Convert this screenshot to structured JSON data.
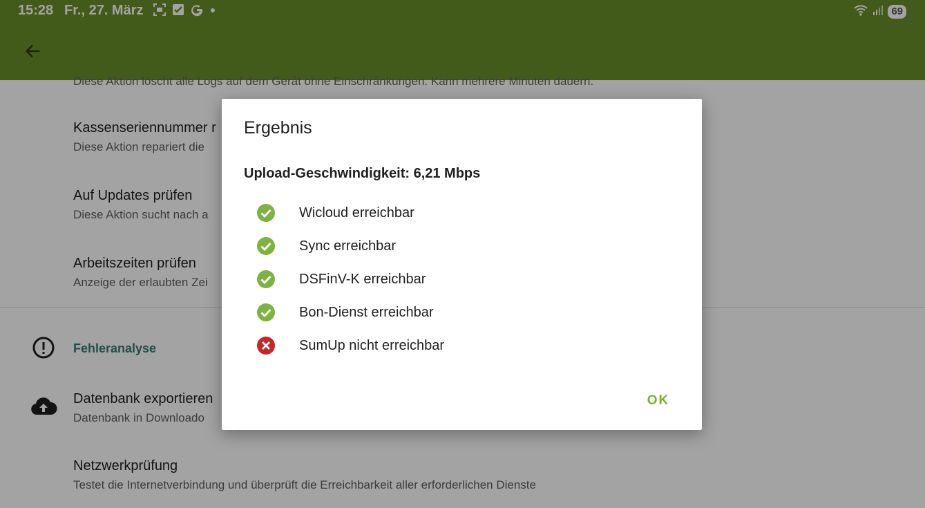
{
  "status_bar": {
    "time": "15:28",
    "date": "Fr., 27. März",
    "battery": "69",
    "icons": [
      "screenshot-icon",
      "task-check-icon",
      "google-icon",
      "dot-icon",
      "wifi-icon",
      "signal-icon"
    ]
  },
  "app_bar": {
    "back_icon": "back-arrow-icon",
    "color": "#6a8f2a"
  },
  "settings": {
    "truncated_top_subtitle": "Diese Aktion löscht alle Logs auf dem Gerät ohne Einschränkungen. Kann mehrere Minuten dauern.",
    "items": [
      {
        "title": "Kassenseriennummer r",
        "subtitle": "Diese Aktion repariert die"
      },
      {
        "title": "Auf Updates prüfen",
        "subtitle": "Diese Aktion sucht nach a"
      },
      {
        "title": "Arbeitszeiten prüfen",
        "subtitle": "Anzeige der erlaubten Zei"
      }
    ],
    "section": {
      "title": "Fehleranalyse",
      "icon": "alert-circle-icon",
      "color": "#2f7d74"
    },
    "section_items": [
      {
        "title": "Datenbank exportieren",
        "subtitle": "Datenbank in Downloado",
        "icon": "cloud-upload-icon"
      },
      {
        "title": "Netzwerkprüfung",
        "subtitle": "Testet die Internetverbindung und überprüft die Erreichbarkeit aller erforderlichen Dienste"
      }
    ]
  },
  "dialog": {
    "title": "Ergebnis",
    "upload_speed": "Upload-Geschwindigkeit: 6,21 Mbps",
    "checks": [
      {
        "label": "Wicloud erreichbar",
        "status": "ok",
        "icon": "check-circle-icon"
      },
      {
        "label": "Sync erreichbar",
        "status": "ok",
        "icon": "check-circle-icon"
      },
      {
        "label": "DSFinV-K erreichbar",
        "status": "ok",
        "icon": "check-circle-icon"
      },
      {
        "label": "Bon-Dienst erreichbar",
        "status": "ok",
        "icon": "check-circle-icon"
      },
      {
        "label": "SumUp nicht erreichbar",
        "status": "error",
        "icon": "error-circle-icon"
      }
    ],
    "ok_label": "OK",
    "colors": {
      "ok": "#7cb342",
      "error": "#c62828",
      "button": "#7fae2e"
    }
  }
}
